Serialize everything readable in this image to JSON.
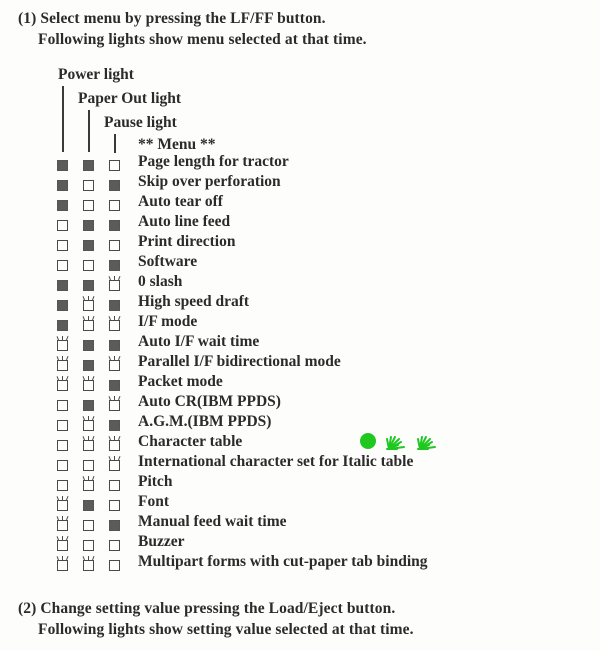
{
  "doc": {
    "background": "#fdfdfc",
    "ink": "#2b2b2b"
  },
  "intro": {
    "line1": "(1) Select menu by pressing the LF/FF button.",
    "line2": "Following lights show menu selected at that time."
  },
  "outro": {
    "line1": "(2) Change setting value pressing the Load/Eject button.",
    "line2": "Following lights show setting value selected at that time."
  },
  "legend": {
    "power": "Power light",
    "paper_out": "Paper Out light",
    "pause": "Pause light",
    "menu": "** Menu **"
  },
  "annotation": {
    "color": "#1fc81f",
    "dot_name": "green-circle-annotation",
    "sparkle_name": "green-sparkle-annotation",
    "sparkle_count": 2,
    "attached_to_row": "Character table"
  },
  "legend_states": {
    "on": "lit",
    "off": "unlit",
    "flash": "flashing"
  },
  "table": {
    "columns": [
      "Power light",
      "Paper Out light",
      "Pause light",
      "** Menu **"
    ],
    "rows": [
      {
        "states": [
          "on",
          "on",
          "off"
        ],
        "label": "Page length for tractor"
      },
      {
        "states": [
          "on",
          "off",
          "on"
        ],
        "label": "Skip over perforation"
      },
      {
        "states": [
          "on",
          "off",
          "off"
        ],
        "label": "Auto tear off"
      },
      {
        "states": [
          "off",
          "on",
          "on"
        ],
        "label": "Auto line feed"
      },
      {
        "states": [
          "off",
          "on",
          "off"
        ],
        "label": "Print direction"
      },
      {
        "states": [
          "off",
          "off",
          "on"
        ],
        "label": "Software"
      },
      {
        "states": [
          "on",
          "on",
          "flash"
        ],
        "label": "0 slash"
      },
      {
        "states": [
          "on",
          "flash",
          "on"
        ],
        "label": "High speed draft"
      },
      {
        "states": [
          "on",
          "flash",
          "flash"
        ],
        "label": "I/F mode"
      },
      {
        "states": [
          "flash",
          "on",
          "on"
        ],
        "label": "Auto I/F wait time"
      },
      {
        "states": [
          "flash",
          "on",
          "flash"
        ],
        "label": "Parallel I/F bidirectional mode"
      },
      {
        "states": [
          "flash",
          "flash",
          "on"
        ],
        "label": "Packet mode"
      },
      {
        "states": [
          "off",
          "on",
          "flash"
        ],
        "label": "Auto CR(IBM PPDS)"
      },
      {
        "states": [
          "off",
          "flash",
          "on"
        ],
        "label": "A.G.M.(IBM PPDS)"
      },
      {
        "states": [
          "off",
          "flash",
          "flash"
        ],
        "label": "Character table",
        "annotated": true
      },
      {
        "states": [
          "off",
          "off",
          "flash"
        ],
        "label": "International character set for Italic table"
      },
      {
        "states": [
          "off",
          "flash",
          "off"
        ],
        "label": "Pitch"
      },
      {
        "states": [
          "flash",
          "on",
          "off"
        ],
        "label": "Font"
      },
      {
        "states": [
          "flash",
          "off",
          "on"
        ],
        "label": "Manual feed wait time"
      },
      {
        "states": [
          "flash",
          "off",
          "off"
        ],
        "label": "Buzzer"
      },
      {
        "states": [
          "flash",
          "flash",
          "off"
        ],
        "label": "Multipart forms with cut-paper tab binding"
      }
    ]
  }
}
